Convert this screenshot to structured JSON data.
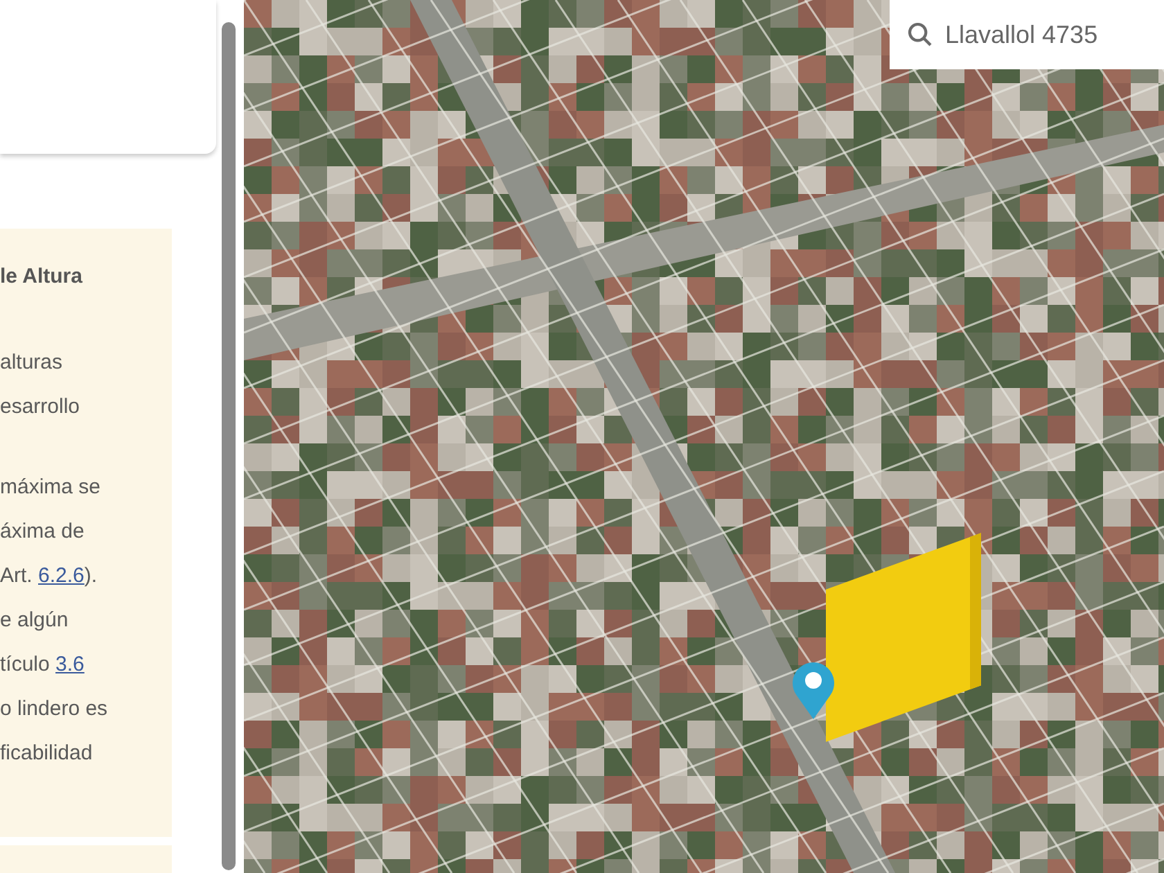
{
  "info_card": {
    "heading": "le Altura",
    "paragraphs": [
      [
        {
          "text": "alturas"
        },
        {
          "text": "esarrollo"
        }
      ],
      [
        {
          "text": "máxima se"
        },
        {
          "text": "áxima de"
        },
        {
          "text": "Art. ",
          "link": "6.2.6",
          "after": ")."
        },
        {
          "text": "e algún"
        },
        {
          "text": "tículo ",
          "link": "3.6"
        },
        {
          "text": "o lindero es"
        },
        {
          "text": "ficabilidad"
        }
      ]
    ]
  },
  "map": {
    "search": {
      "value": "Llavallol 4735"
    }
  }
}
